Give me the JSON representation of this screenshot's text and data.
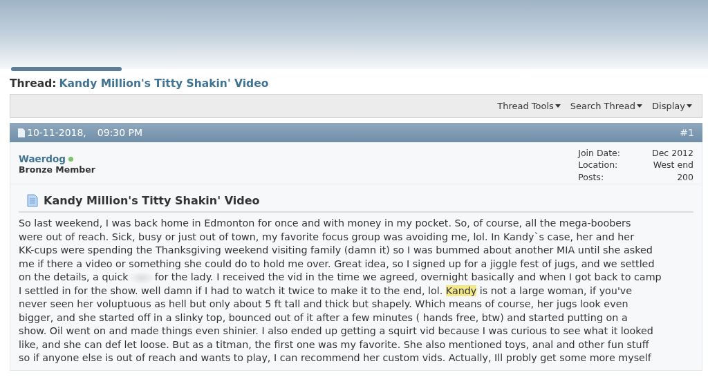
{
  "thread": {
    "label": "Thread:",
    "title": "Kandy Million's Titty Shakin' Video"
  },
  "toolbar": [
    {
      "label": "Thread Tools"
    },
    {
      "label": "Search Thread"
    },
    {
      "label": "Display"
    }
  ],
  "post": {
    "date": "10-11-2018,",
    "time": "09:30 PM",
    "number": "#1",
    "user": {
      "name": "Waerdog",
      "online": true,
      "rank": "Bronze Member"
    },
    "info": [
      {
        "label": "Join Date:",
        "value": "Dec 2012"
      },
      {
        "label": "Location:",
        "value": "West end"
      },
      {
        "label": "Posts:",
        "value": "200"
      }
    ],
    "title": "Kandy Million's Titty Shakin' Video",
    "lines": [
      [
        {
          "text": "So last weekend, I was back home in Edmonton for once and with money in my pocket. So, of course, all the mega-boobers",
          "highlighted": false
        }
      ],
      [
        {
          "text": "were out of reach. Sick, busy or just out of town, my favorite focus group was avoiding me, lol. In Kandy`s case, her and her",
          "highlighted": false
        }
      ],
      [
        {
          "text": "KK-cups were spending the Thanksgiving weekend visiting family (damn it) so I was bummed about another MIA until she asked",
          "highlighted": false
        }
      ],
      [
        {
          "text": "me if there a video or something she could do to hold me over. Great idea, so I signed up for a jiggle fest of jugs, and we settled",
          "highlighted": false
        }
      ],
      [
        {
          "text": "on the details, a quick",
          "highlighted": false
        },
        {
          "text": "for the lady. I received the vid in the time we agreed, overnight basically and when I got back to camp",
          "highlighted": false
        }
      ],
      [
        {
          "text": "I settled in for the show. well damn if I had to watch it twice to make it to the end, lol.",
          "highlighted": false
        },
        {
          "text": "Kandy",
          "highlighted": true
        },
        {
          "text": "is not a large woman, if you've",
          "highlighted": false
        }
      ],
      [
        {
          "text": "never seen her voluptuous as hell but only about 5 ft tall and thick but shapely. Which means of course, her jugs look even",
          "highlighted": false
        }
      ],
      [
        {
          "text": "bigger, and she started off in a slinky top, bounced out of it after a few minutes ( hands free, btw) and started putting on a",
          "highlighted": false
        }
      ],
      [
        {
          "text": "show. Oil went on and made things even shinier. I also ended up getting a squirt vid because I was curious to see what it looked",
          "highlighted": false
        }
      ],
      [
        {
          "text": "like, and she can def let loose. But as a titman, the first one was my favorite. She also mentioned toys, anal and other fun stuff",
          "highlighted": false
        }
      ],
      [
        {
          "text": "so if anyone else is out of reach and wants to play, I can recommend her custom vids. Actually, Ill probly get some more myself",
          "highlighted": false
        }
      ]
    ]
  }
}
